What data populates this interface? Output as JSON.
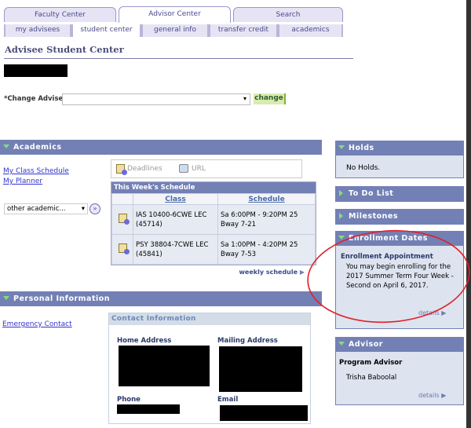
{
  "tabs": [
    {
      "label": "Faculty Center"
    },
    {
      "label": "Advisor Center",
      "active": true
    },
    {
      "label": "Search"
    }
  ],
  "subtabs": [
    {
      "label": "my advisees"
    },
    {
      "label": "student center",
      "active": true
    },
    {
      "label": "general info"
    },
    {
      "label": "transfer credit"
    },
    {
      "label": "academics"
    }
  ],
  "page_title": "Advisee Student Center",
  "change_advisee": {
    "label": "*Change Advisee",
    "value": "",
    "button": "change"
  },
  "academics": {
    "header": "Academics",
    "links": [
      "My Class Schedule",
      "My Planner"
    ],
    "other_select": "other academic...",
    "deadlines": "Deadlines",
    "url": "URL",
    "schedule": {
      "title": "This Week's Schedule",
      "columns": [
        "Class",
        "Schedule"
      ],
      "rows": [
        {
          "class": "IAS 10400-6CWE LEC (45714)",
          "schedule": "Sa 6:00PM - 9:20PM 25 Bway 7-21"
        },
        {
          "class": "PSY 38804-7CWE LEC (45841)",
          "schedule": "Sa 1:00PM - 4:20PM 25 Bway 7-53"
        }
      ]
    },
    "weekly_link": "weekly schedule"
  },
  "personal": {
    "header": "Personal Information",
    "emergency": "Emergency Contact",
    "contact_title": "Contact Information",
    "home": "Home Address",
    "mailing": "Mailing Address",
    "phone": "Phone",
    "email": "Email"
  },
  "holds": {
    "header": "Holds",
    "text": "No Holds."
  },
  "todo": {
    "header": "To Do List"
  },
  "milestones": {
    "header": "Milestones"
  },
  "enrollment": {
    "header": "Enrollment Dates",
    "subtitle": "Enrollment Appointment",
    "text": "You may begin enrolling for the 2017 Summer Term Four Week - Second on April 6, 2017.",
    "details": "details"
  },
  "advisor": {
    "header": "Advisor",
    "subtitle": "Program Advisor",
    "name": "Trisha Baboolal",
    "details": "details"
  },
  "colors": {
    "header": "#7380b5",
    "annotation": "#e0202a",
    "button": "#d8ecb0"
  }
}
